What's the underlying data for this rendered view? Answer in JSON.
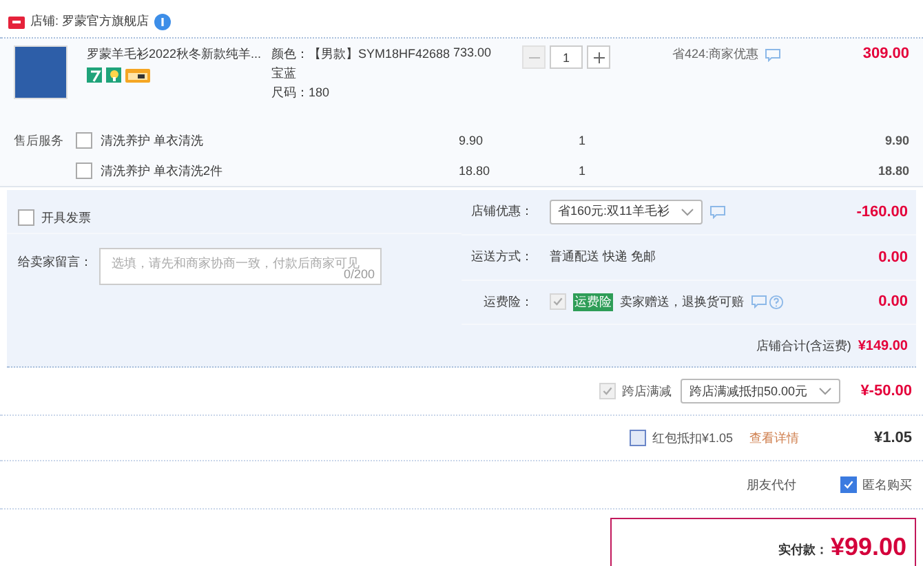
{
  "shop": {
    "name": "店铺: 罗蒙官方旗舰店"
  },
  "item": {
    "title": "罗蒙羊毛衫2022秋冬新款纯羊...",
    "specs": [
      "颜色：【男款】SYM18HF42688",
      "宝蓝",
      "尺码：180"
    ],
    "price": "733.00",
    "quantity": "1",
    "discount": "省424:商家优惠",
    "subtotal": "309.00"
  },
  "services": {
    "label": "售后服务",
    "items": [
      {
        "text": "清洗养护 单衣清洗",
        "checked": false,
        "price": "9.90",
        "quantity": "1",
        "subtotal": "9.90"
      },
      {
        "text": "清洗养护 单衣清洗2件",
        "checked": false,
        "price": "18.80",
        "quantity": "1",
        "subtotal": "18.80"
      }
    ]
  },
  "invoice": {
    "label": "开具发票",
    "checked": false
  },
  "message": {
    "label": "给卖家留言：",
    "placeholder": "选填，请先和商家协商一致，付款后商家可见",
    "counter": "0/200"
  },
  "order_rows": [
    {
      "kind": "select",
      "label": "店铺优惠：",
      "value": "省160元:双11羊毛衫",
      "amount": "-160.00"
    },
    {
      "kind": "text",
      "label": "运送方式：",
      "value": "普通配送 快递 免邮",
      "amount": "0.00"
    },
    {
      "kind": "insurance",
      "label": "运费险：",
      "checked": true,
      "badge": "运费险",
      "value": "卖家赠送，退换货可赔",
      "amount": "0.00"
    }
  ],
  "shop_total": {
    "label": "店铺合计(含运费)",
    "amount": "¥149.00"
  },
  "cross_store": {
    "checked": true,
    "label": "跨店满减",
    "value": "跨店满减抵扣50.00元",
    "amount": "¥-50.00"
  },
  "red_packet": {
    "checked": false,
    "label": "红包抵扣¥1.05",
    "link": "查看详情",
    "amount": "¥1.05"
  },
  "friend_pay": {
    "label": "朋友代付"
  },
  "anonymous": {
    "checked": true,
    "label": "匿名购买"
  },
  "payment": {
    "label": "实付款：",
    "amount": "¥99.00"
  }
}
